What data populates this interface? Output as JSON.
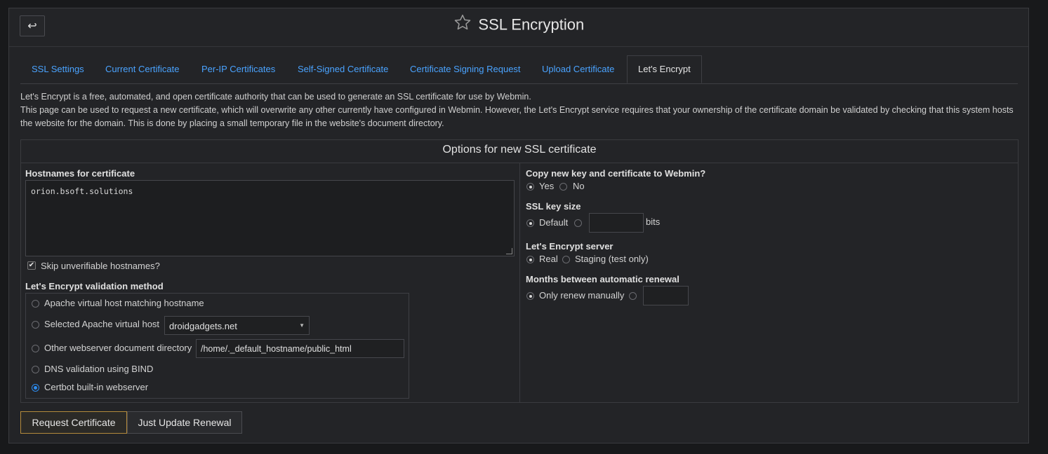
{
  "header": {
    "back_icon": "↩",
    "title": "SSL Encryption"
  },
  "tabs": [
    {
      "label": "SSL Settings"
    },
    {
      "label": "Current Certificate"
    },
    {
      "label": "Per-IP Certificates"
    },
    {
      "label": "Self-Signed Certificate"
    },
    {
      "label": "Certificate Signing Request"
    },
    {
      "label": "Upload Certificate"
    },
    {
      "label": "Let's Encrypt"
    }
  ],
  "intro": {
    "line1": "Let's Encrypt is a free, automated, and open certificate authority that can be used to generate an SSL certificate for use by Webmin.",
    "line2": "This page can be used to request a new certificate, which will overwrite any other currently have configured in Webmin. However, the Let's Encrypt service requires that your ownership of the certificate domain be validated by checking that this system hosts the website for the domain. This is done by placing a small temporary file in the website's document directory."
  },
  "options": {
    "title": "Options for new SSL certificate",
    "hostnames_label": "Hostnames for certificate",
    "hostnames_value": "orion.bsoft.solutions",
    "skip_label": "Skip unverifiable hostnames?",
    "validation_label": "Let's Encrypt validation method",
    "validation": {
      "apache_match": "Apache virtual host matching hostname",
      "apache_selected": "Selected Apache virtual host",
      "apache_selected_value": "droidgadgets.net",
      "other_dir": "Other webserver document directory",
      "other_dir_value": "/home/._default_hostname/public_html",
      "dns": "DNS validation using BIND",
      "certbot": "Certbot built-in webserver"
    },
    "copy_label": "Copy new key and certificate to Webmin?",
    "copy_yes": "Yes",
    "copy_no": "No",
    "keysize_label": "SSL key size",
    "keysize_default": "Default",
    "keysize_unit": "bits",
    "server_label": "Let's Encrypt server",
    "server_real": "Real",
    "server_staging": "Staging (test only)",
    "renew_label": "Months between automatic renewal",
    "renew_manual": "Only renew manually"
  },
  "buttons": {
    "request": "Request Certificate",
    "renewal": "Just Update Renewal"
  },
  "colors": {
    "link": "#4aa3ff",
    "panel": "#232427",
    "primary_border": "#b38a3c"
  }
}
